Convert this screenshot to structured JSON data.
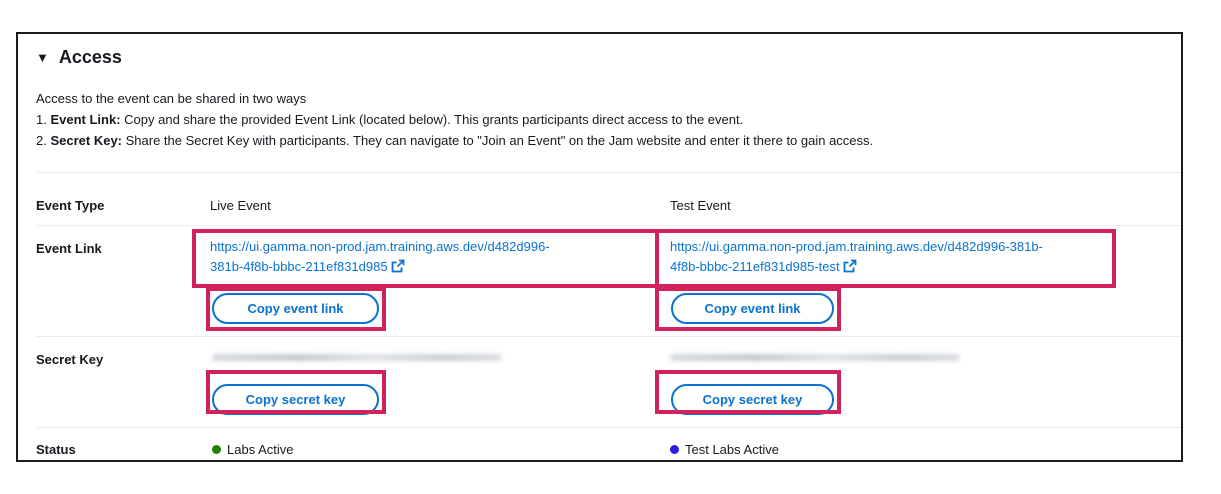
{
  "section": {
    "title": "Access",
    "intro": "Access to the event can be shared in two ways",
    "item1_num": "1. ",
    "item1_label": "Event Link:",
    "item1_text": " Copy and share the provided Event Link (located below). This grants participants direct access to the event.",
    "item2_num": "2. ",
    "item2_label": "Secret Key:",
    "item2_text": " Share the Secret Key with participants. They can navigate to \"Join an Event\" on the Jam website and enter it there to gain access."
  },
  "rows": {
    "event_type_label": "Event Type",
    "event_link_label": "Event Link",
    "secret_key_label": "Secret Key",
    "status_label": "Status"
  },
  "live": {
    "type": "Live Event",
    "link_line1": "https://ui.gamma.non-prod.jam.training.aws.dev/d482d996-",
    "link_line2": "381b-4f8b-bbbc-211ef831d985",
    "copy_link": "Copy event link",
    "copy_key": "Copy secret key",
    "status": "Labs Active",
    "status_color": "#1d8102"
  },
  "test": {
    "type": "Test Event",
    "link_line1": "https://ui.gamma.non-prod.jam.training.aws.dev/d482d996-381b-",
    "link_line2": "4f8b-bbbc-211ef831d985-test",
    "copy_link": "Copy event link",
    "copy_key": "Copy secret key",
    "status": "Test Labs Active",
    "status_color": "#2b1de0"
  },
  "colors": {
    "link": "#0972d3",
    "highlight": "#d1235b"
  },
  "icons": {
    "caret": "caret-down-icon",
    "external": "external-link-icon"
  }
}
